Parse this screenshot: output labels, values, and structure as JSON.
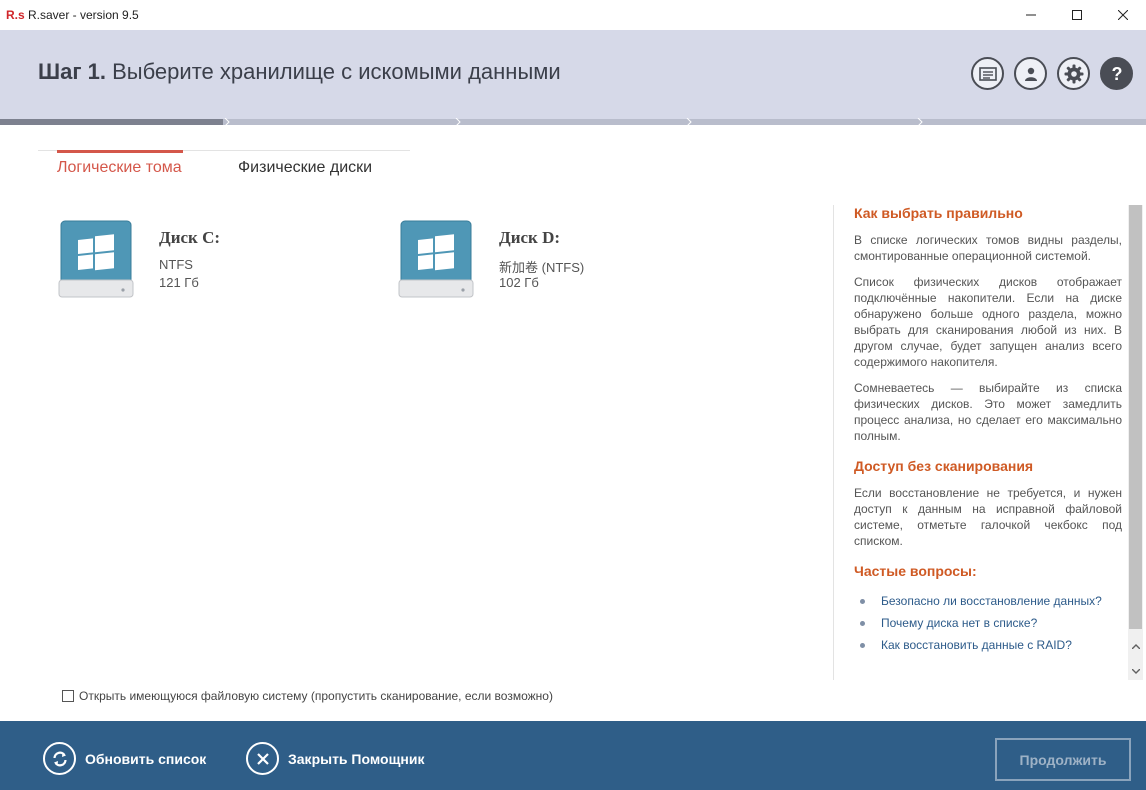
{
  "window": {
    "logo": "R.s",
    "title": "R.saver - version 9.5"
  },
  "header": {
    "step_number": "Шаг 1.",
    "step_text": "Выберите хранилище с искомыми данными",
    "progress_fraction": 0.195
  },
  "tabs": [
    {
      "label": "Логические тома",
      "active": true
    },
    {
      "label": "Физические диски",
      "active": false
    }
  ],
  "disks": [
    {
      "name": "Диск C:",
      "fs": "NTFS",
      "size": "121 Гб"
    },
    {
      "name": "Диск D:",
      "fs": "新加卷 (NTFS)",
      "size": "102 Гб"
    }
  ],
  "help": {
    "h1": "Как выбрать правильно",
    "p1": "В списке логических томов видны разделы, смонтированные операционной системой.",
    "p2": "Список физических дисков отображает подключённые накопители. Если на диске обнаружено больше одного раздела, можно выбрать для сканирования любой из них. В другом случае, будет запущен анализ всего содержимого накопителя.",
    "p3": "Сомневаетесь — выбирайте из списка физических дисков. Это может замедлить процесс анализа, но сделает его максимально полным.",
    "h2": "Доступ без сканирования",
    "p4": "Если восстановление не требуется, и нужен доступ к данным на исправной файловой системе, отметьте галочкой чекбокс под списком.",
    "h3": "Частые вопросы:",
    "faq": [
      "Безопасно ли восстановление данных?",
      "Почему диска нет в списке?",
      "Как восстановить данные с RAID?"
    ]
  },
  "checkbox": {
    "label": "Открыть имеющуюся файловую систему (пропустить сканирование, если возможно)",
    "checked": false
  },
  "footer": {
    "refresh_label": "Обновить список",
    "close_label": "Закрыть Помощник",
    "continue_label": "Продолжить"
  },
  "colors": {
    "header_bg": "#d6d9e8",
    "footer_bg": "#2f5e88",
    "accent_tab": "#d4574a",
    "help_heading": "#cf5a24",
    "disk_icon": "#4f97b6"
  }
}
